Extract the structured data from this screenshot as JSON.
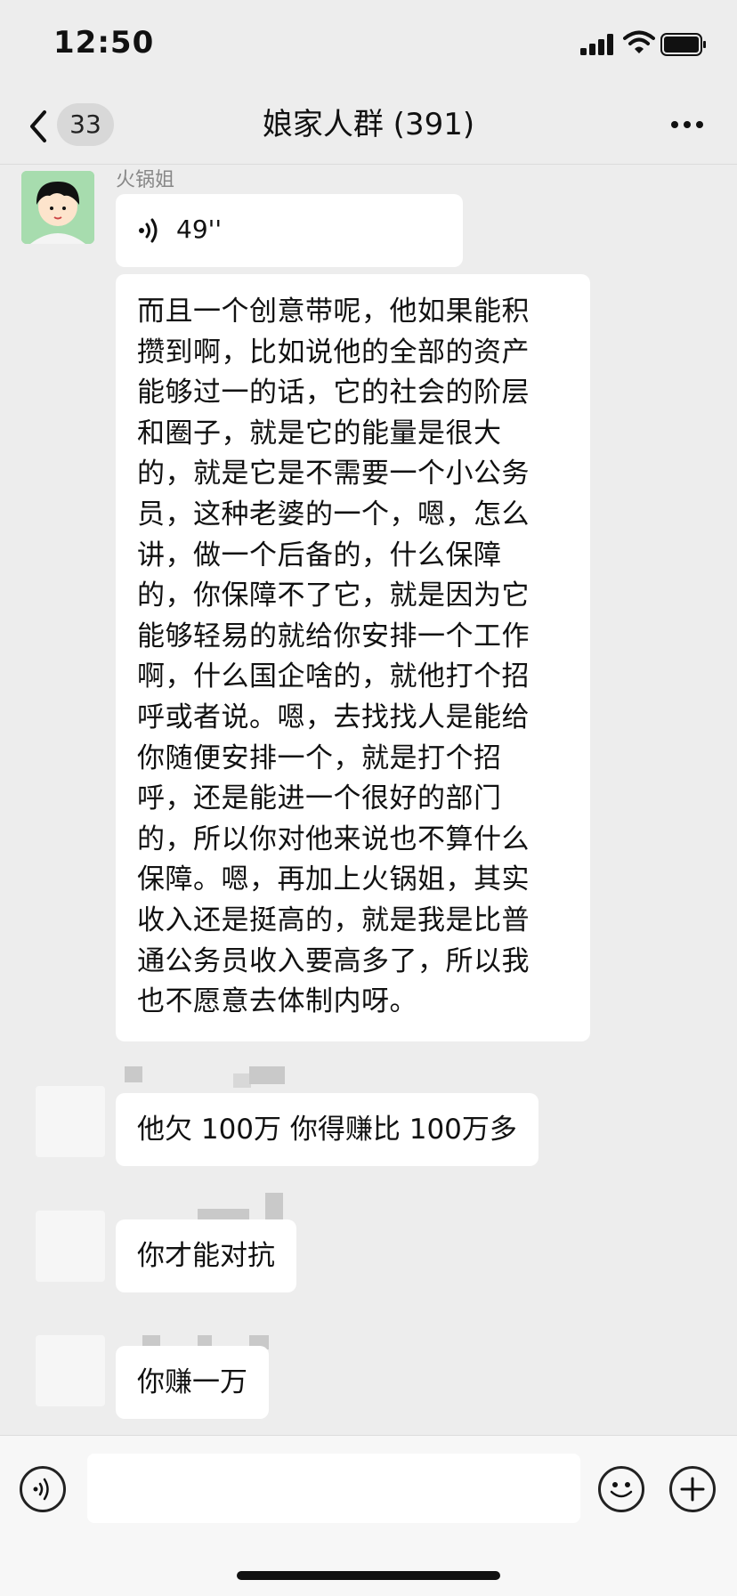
{
  "status_bar": {
    "time": "12:50"
  },
  "header": {
    "back_count": "33",
    "title": "娘家人群 (391)"
  },
  "messages": [
    {
      "sender": "火锅姐",
      "type": "voice",
      "duration": "49''"
    },
    {
      "type": "text",
      "lines": [
        "而且一个创意带呢，他如果能积",
        "攒到啊，比如说他的全部的资产",
        "能够过一的话，它的社会的阶层",
        "和圈子，就是它的能量是很大",
        "的，就是它是不需要一个小公务",
        "员，这种老婆的一个，嗯，怎么",
        "讲，做一个后备的，什么保障",
        "的，你保障不了它，就是因为它",
        "能够轻易的就给你安排一个工作",
        "啊，什么国企啥的，就他打个招",
        "呼或者说。嗯，去找找人是能给",
        "你随便安排一个，就是打个招",
        "呼，还是能进一个很好的部门",
        "的，所以你对他来说也不算什么",
        "保障。嗯，再加上火锅姐，其实",
        "收入还是挺高的，就是我是比普",
        "通公务员收入要高多了，所以我",
        "也不愿意去体制内呀。"
      ]
    },
    {
      "type": "text",
      "text": "他欠 100万 你得赚比 100万多"
    },
    {
      "type": "text",
      "text": "你才能对抗"
    },
    {
      "type": "text",
      "text": "你赚一万"
    }
  ],
  "icons": {
    "back": "chevron-left-icon",
    "more": "more-icon",
    "voice": "voice-icon",
    "emoji": "emoji-icon",
    "add": "add-icon"
  },
  "colors": {
    "background": "#ededed",
    "bubble": "#ffffff",
    "input_bar": "#f7f7f7"
  }
}
